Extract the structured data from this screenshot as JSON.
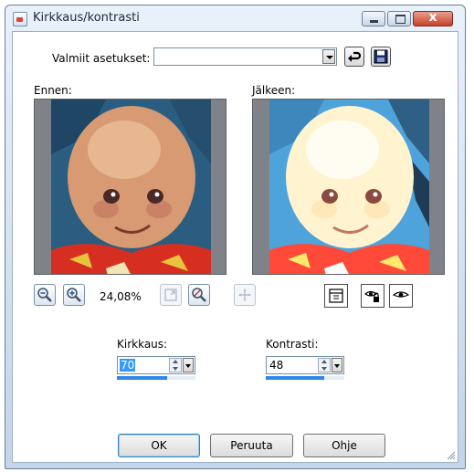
{
  "window": {
    "title": "Kirkkaus/kontrasti",
    "controls": [
      "minimize",
      "maximize",
      "close"
    ],
    "close_glyph": "x"
  },
  "presets": {
    "label": "Valmiit asetukset:",
    "value": "",
    "reset_icon": "reset-arrow-icon",
    "save_icon": "floppy-disk-icon"
  },
  "preview": {
    "before_label": "Ennen:",
    "after_label": "Jälkeen:",
    "zoom": "24,08%"
  },
  "toolbar_icons": [
    "zoom-out-icon",
    "zoom-in-icon",
    "zoom-to-fit-icon",
    "actual-size-icon",
    "pan-icon"
  ],
  "view_icons": [
    "toggle-preview-icon",
    "auto-proof-icon",
    "proof-eye-icon"
  ],
  "brightness": {
    "label": "Kirkkaus:",
    "value": "70",
    "level_percent": 64
  },
  "contrast": {
    "label": "Kontrasti:",
    "value": "48",
    "level_percent": 74
  },
  "buttons": {
    "ok": "OK",
    "cancel": "Peruuta",
    "help": "Ohje"
  },
  "colors": {
    "accent": "#2e86e8",
    "selection": "#3399ff",
    "title_bg": "#c3d5ea"
  }
}
